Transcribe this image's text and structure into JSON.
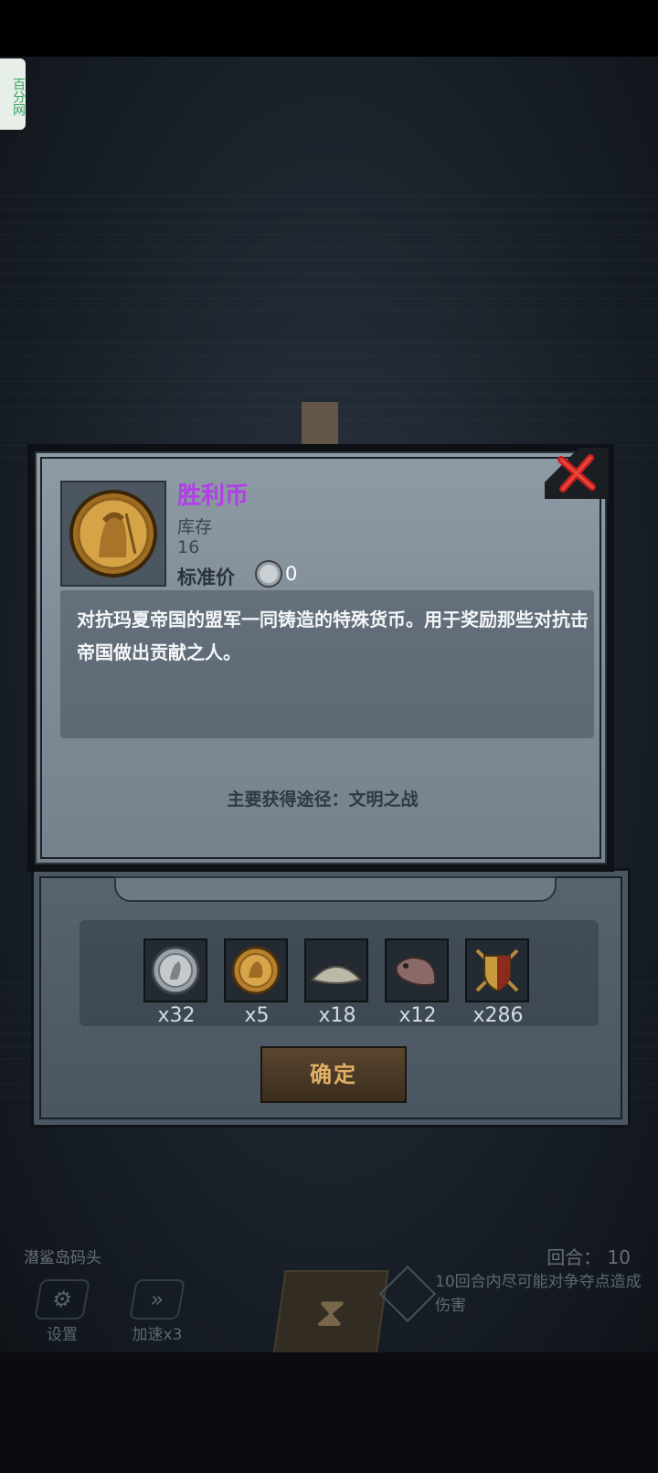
{
  "watermark": {
    "text": "百分网"
  },
  "item": {
    "name": "胜利币",
    "stock_label": "库存",
    "stock_value": "16",
    "price_label": "标准价",
    "price_value": "0",
    "description": "对抗玛夏帝国的盟军一同铸造的特殊货币。用于奖励那些对抗击帝国做出贡献之人。",
    "source": "主要获得途径：文明之战"
  },
  "rewards": {
    "items": [
      {
        "icon": "silver-coin-icon",
        "count": "x32"
      },
      {
        "icon": "victory-coin-icon",
        "count": "x5"
      },
      {
        "icon": "flour-icon",
        "count": "x18"
      },
      {
        "icon": "fish-icon",
        "count": "x12"
      },
      {
        "icon": "shield-swords-icon",
        "count": "x286"
      }
    ],
    "confirm_label": "确定"
  },
  "hud": {
    "location": "潜鲨岛码头",
    "round": "回合： 10",
    "settings_label": "设置",
    "speed_label": "加速x3",
    "tip": "10回合内尽可能对争夺点造成伤害"
  },
  "colors": {
    "item_name": "#b23ee8",
    "close": "#c81e1e",
    "confirm_text": "#e2b064"
  }
}
